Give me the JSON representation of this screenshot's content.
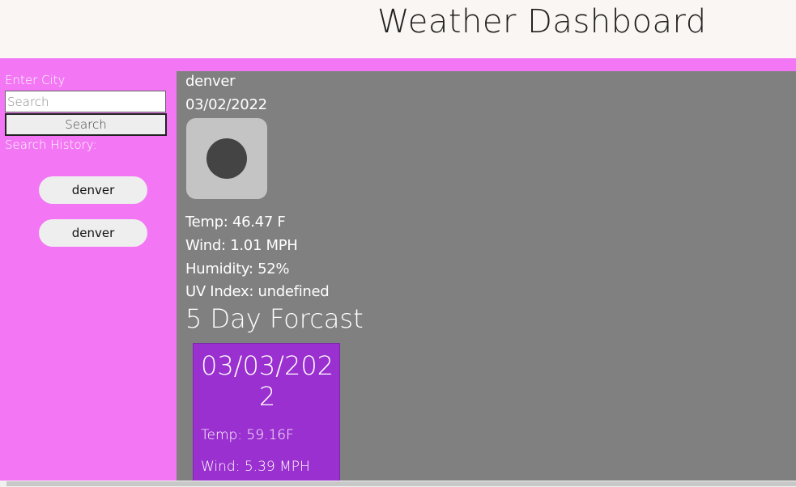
{
  "header": {
    "title": "Weather Dashboard"
  },
  "sidebar": {
    "enter_label": "Enter City",
    "search_placeholder": "Search",
    "search_button": "Search",
    "history_label": "Search History:",
    "history": [
      "denver",
      "denver"
    ]
  },
  "current": {
    "city": "denver",
    "date": "03/02/2022",
    "icon": "weather-icon",
    "temp": "Temp: 46.47 F",
    "wind": "Wind: 1.01 MPH",
    "humidity": "Humidity: 52%",
    "uv": "UV Index: undefined"
  },
  "forecast": {
    "title": "5 Day Forcast",
    "days": [
      {
        "date": "03/03/2022",
        "temp": "Temp: 59.16F",
        "wind": "Wind: 5.39 MPH"
      }
    ]
  }
}
